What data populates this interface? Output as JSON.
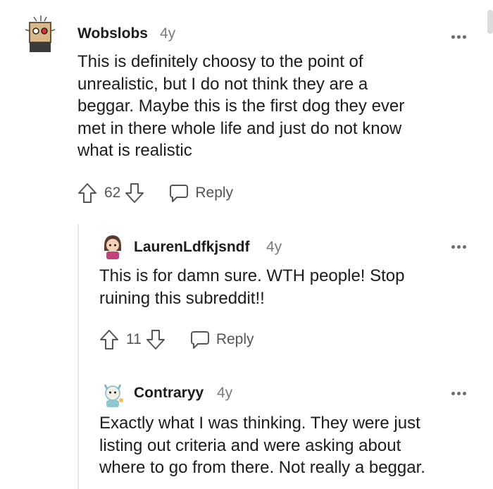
{
  "comments": [
    {
      "username": "Wobslobs",
      "age": "4y",
      "text_lines": [
        "This is definitely choosy to the point of",
        "unrealistic, but I do not think they are a",
        "beggar. Maybe this is the first dog they ever",
        "met in there whole life and just do not know",
        "what is realistic"
      ],
      "votes": "62",
      "reply_label": "Reply"
    },
    {
      "username": "LaurenLdfkjsndf",
      "age": "4y",
      "text_lines": [
        "This is for damn sure. WTH people! Stop",
        "ruining this subreddit!!"
      ],
      "votes": "11",
      "reply_label": "Reply"
    },
    {
      "username": "Contraryy",
      "age": "4y",
      "text_lines": [
        "Exactly what I was thinking. They were just",
        "listing out criteria and were asking about",
        "where to go from there. Not really a beggar."
      ]
    }
  ],
  "icons": {
    "upvote": "arrow-up-icon",
    "downvote": "arrow-down-icon",
    "reply": "speech-bubble-icon",
    "more": "more-dots-icon"
  }
}
